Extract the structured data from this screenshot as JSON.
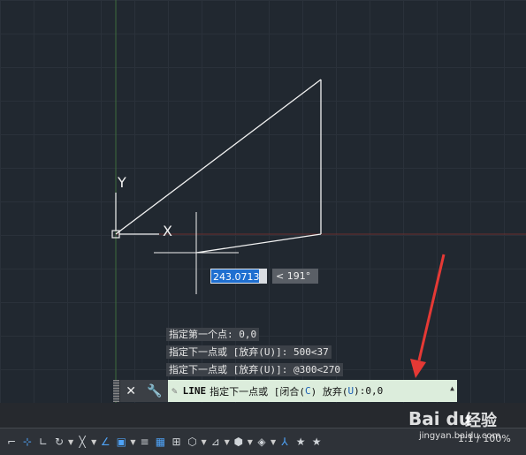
{
  "canvas": {
    "ucs_y_label": "Y",
    "ucs_x_label": "X"
  },
  "command_history": [
    "指定第一个点: 0,0",
    "指定下一点或 [放弃(U)]: 500<37",
    "指定下一点或 [放弃(U)]: @300<270"
  ],
  "dynamic_input": {
    "distance": "243.0713",
    "angle": "< 191°"
  },
  "command_line": {
    "command": "LINE",
    "prompt": "指定下一点或 [闭合(",
    "opt1_key": "C",
    "mid": ") 放弃(",
    "opt2_key": "U",
    "end": "): ",
    "value": "0,0"
  },
  "status_bar": {
    "scale": "1:1 / 100%"
  },
  "watermark": {
    "logo": "Bai du",
    "text": "经验",
    "url": "jingyan.baidu.com"
  },
  "colors": {
    "canvas_bg": "#212830",
    "accent": "#1f6fd0",
    "arrow": "#e53935"
  }
}
